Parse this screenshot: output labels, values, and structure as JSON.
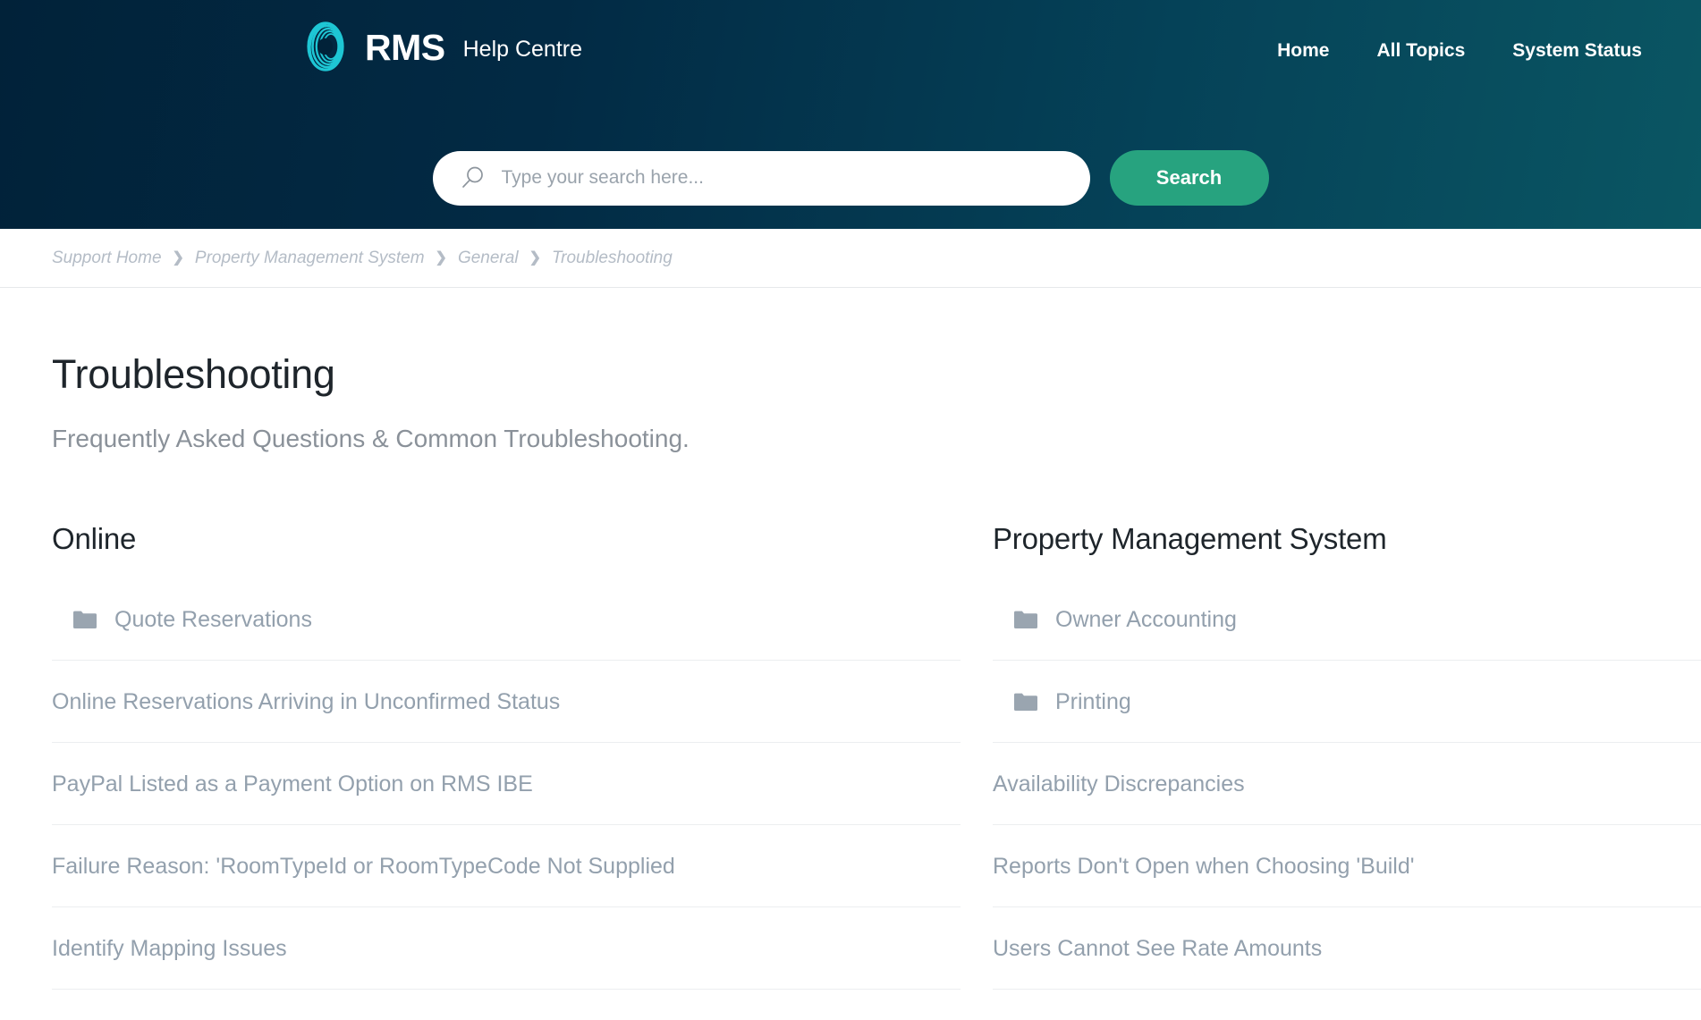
{
  "header": {
    "brand_name": "RMS",
    "brand_subtitle": "Help Centre",
    "logo_icon": "rms-spiral-logo-icon",
    "logo_color": "#1ec6d4",
    "gradient_from": "#012239",
    "gradient_to": "#0a5663",
    "nav": [
      {
        "label": "Home"
      },
      {
        "label": "All Topics"
      },
      {
        "label": "System Status"
      }
    ]
  },
  "search": {
    "icon": "search-icon",
    "placeholder": "Type your search here...",
    "value": "",
    "button_label": "Search",
    "button_color": "#27a37f"
  },
  "breadcrumb": {
    "separator": "❯",
    "items": [
      {
        "label": "Support Home"
      },
      {
        "label": "Property Management System"
      },
      {
        "label": "General"
      },
      {
        "label": "Troubleshooting"
      }
    ]
  },
  "page": {
    "title": "Troubleshooting",
    "subtitle": "Frequently Asked Questions & Common Troubleshooting."
  },
  "columns": [
    {
      "heading": "Online",
      "entries": [
        {
          "label": "Quote Reservations",
          "type": "folder",
          "icon": "folder-icon"
        },
        {
          "label": "Online Reservations Arriving in Unconfirmed Status",
          "type": "article"
        },
        {
          "label": "PayPal Listed as a Payment Option on RMS IBE",
          "type": "article"
        },
        {
          "label": "Failure Reason: 'RoomTypeId or RoomTypeCode Not Supplied",
          "type": "article"
        },
        {
          "label": "Identify Mapping Issues",
          "type": "article"
        }
      ]
    },
    {
      "heading": "Property Management System",
      "entries": [
        {
          "label": "Owner Accounting",
          "type": "folder",
          "icon": "folder-icon"
        },
        {
          "label": "Printing",
          "type": "folder",
          "icon": "folder-icon"
        },
        {
          "label": "Availability Discrepancies",
          "type": "article"
        },
        {
          "label": "Reports Don't Open when Choosing 'Build'",
          "type": "article"
        },
        {
          "label": "Users Cannot See Rate Amounts",
          "type": "article"
        }
      ]
    }
  ]
}
